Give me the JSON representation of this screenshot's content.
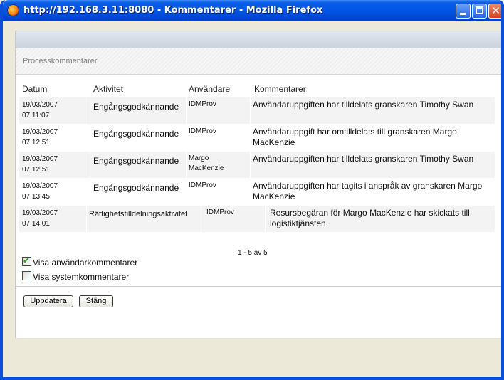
{
  "window": {
    "title": "http://192.168.3.11:8080 - Kommentarer - Mozilla Firefox",
    "app_icon": "firefox-icon",
    "controls": {
      "minimize": "minimize-icon",
      "maximize": "maximize-icon",
      "close": "close-icon",
      "close_glyph": "✕"
    }
  },
  "panel": {
    "title": "Processkommentarer",
    "columns": {
      "date": "Datum",
      "activity": "Aktivitet",
      "user": "Användare",
      "comment": "Kommentarer"
    },
    "rows": [
      {
        "date": "19/03/2007",
        "time": "07:11:07",
        "activity": "Engångsgodkännande",
        "user1": "IDMProv",
        "user2": "",
        "comment1": "Användaruppgiften har tilldelats granskaren Timothy Swan",
        "comment2": ""
      },
      {
        "date": "19/03/2007",
        "time": "07:12:51",
        "activity": "Engångsgodkännande",
        "user1": "IDMProv",
        "user2": "",
        "comment1": "Användaruppgift har omtilldelats till granskaren Margo",
        "comment2": "MacKenzie"
      },
      {
        "date": "19/03/2007",
        "time": "07:12:51",
        "activity": "Engångsgodkännande",
        "user1": "Margo",
        "user2": "MacKenzie",
        "comment1": "Användaruppgiften har tilldelats granskaren Timothy Swan",
        "comment2": ""
      },
      {
        "date": "19/03/2007",
        "time": "07:13:45",
        "activity": "Engångsgodkännande",
        "user1": "IDMProv",
        "user2": "",
        "comment1": "Användaruppgiften har tagits i anspråk av granskaren Margo",
        "comment2": "MacKenzie"
      },
      {
        "date": "19/03/2007",
        "time": "07:14:01",
        "activity": "Rättighetstilldelningsaktivitet",
        "user1": "IDMProv",
        "user2": "",
        "comment1": "Resursbegäran för Margo MacKenzie har skickats till",
        "comment2": "logistiktjänsten"
      }
    ],
    "pager": "1 - 5 av 5",
    "options": [
      {
        "label": "Visa användarkommentarer",
        "checked": true,
        "mark": "✔"
      },
      {
        "label": "Visa systemkommentarer",
        "checked": false,
        "mark": ""
      }
    ],
    "buttons": {
      "update": "Uppdatera",
      "close": "Stäng"
    }
  }
}
